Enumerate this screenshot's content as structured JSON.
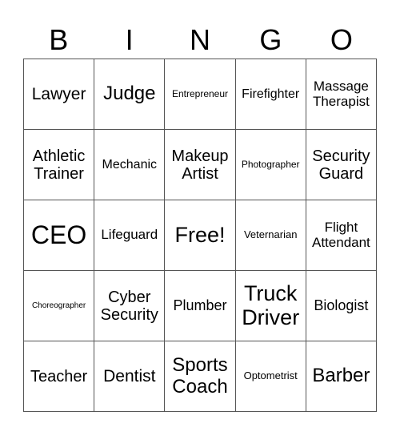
{
  "header": [
    "B",
    "I",
    "N",
    "G",
    "O"
  ],
  "cells": [
    [
      "Lawyer",
      "Judge",
      "Entrepreneur",
      "Firefighter",
      "Massage Therapist"
    ],
    [
      "Athletic Trainer",
      "Mechanic",
      "Makeup Artist",
      "Photographer",
      "Security Guard"
    ],
    [
      "CEO",
      "Lifeguard",
      "Free!",
      "Veternarian",
      "Flight Attendant"
    ],
    [
      "Choreographer",
      "Cyber Security",
      "Plumber",
      "Truck Driver",
      "Biologist"
    ],
    [
      "Teacher",
      "Dentist",
      "Sports Coach",
      "Optometrist",
      "Barber"
    ]
  ]
}
